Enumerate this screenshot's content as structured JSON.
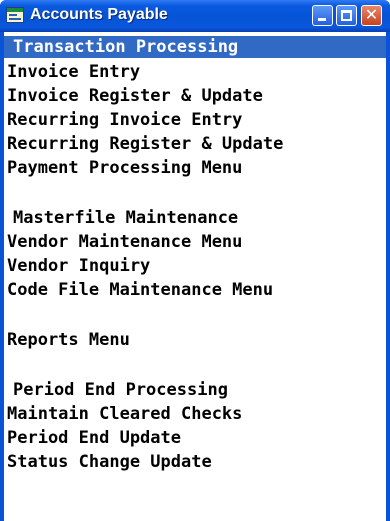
{
  "window": {
    "title": "Accounts Payable",
    "icons": {
      "app": "app-icon",
      "minimize": "minimize-icon",
      "maximize": "maximize-icon",
      "close": "close-icon"
    },
    "close_glyph": "✕"
  },
  "colors": {
    "titlebar": "#0553d6",
    "selection": "#316ac5",
    "close_button": "#c8421f"
  },
  "menu": [
    {
      "label": "Transaction Processing",
      "kind": "header",
      "selected": true
    },
    {
      "label": "Invoice Entry",
      "kind": "item"
    },
    {
      "label": "Invoice Register & Update",
      "kind": "item"
    },
    {
      "label": "Recurring Invoice Entry",
      "kind": "item"
    },
    {
      "label": "Recurring Register & Update",
      "kind": "item"
    },
    {
      "label": "Payment Processing Menu",
      "kind": "item"
    },
    {
      "label": "Masterfile Maintenance",
      "kind": "header"
    },
    {
      "label": "Vendor Maintenance Menu",
      "kind": "item"
    },
    {
      "label": "Vendor Inquiry",
      "kind": "item"
    },
    {
      "label": "Code File Maintenance Menu",
      "kind": "item"
    },
    {
      "label": "Reports Menu",
      "kind": "item"
    },
    {
      "label": "Period End Processing",
      "kind": "header"
    },
    {
      "label": "Maintain Cleared Checks",
      "kind": "item"
    },
    {
      "label": "Period End Update",
      "kind": "item"
    },
    {
      "label": "Status Change Update",
      "kind": "item"
    }
  ]
}
